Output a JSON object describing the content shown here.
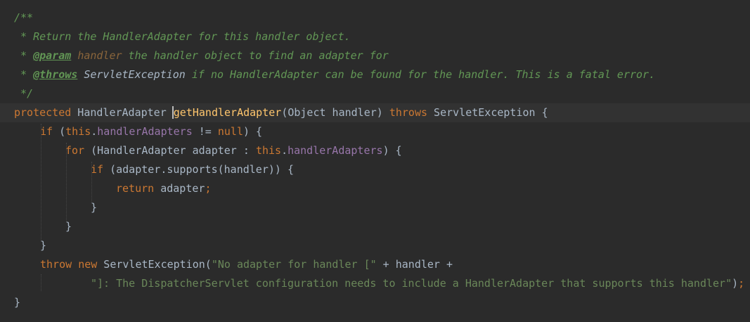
{
  "editor": {
    "colors": {
      "background": "#2b2b2b",
      "current_line": "#323232",
      "comment": "#629755",
      "keyword": "#cc7832",
      "plain": "#a9b7c6",
      "method": "#ffc66d",
      "field": "#9876aa",
      "string": "#6a8759",
      "param_name": "#8a653b"
    },
    "lines": [
      [
        {
          "t": "/**",
          "c": "comment"
        }
      ],
      [
        {
          "t": " * Return the HandlerAdapter for this handler object.",
          "c": "comment"
        }
      ],
      [
        {
          "t": " * ",
          "c": "comment"
        },
        {
          "t": "@param",
          "c": "doctag"
        },
        {
          "t": " ",
          "c": "comment"
        },
        {
          "t": "handler",
          "c": "paramname"
        },
        {
          "t": " the handler object to find an adapter for",
          "c": "comment"
        }
      ],
      [
        {
          "t": " * ",
          "c": "comment"
        },
        {
          "t": "@throws",
          "c": "doctag"
        },
        {
          "t": " ",
          "c": "comment"
        },
        {
          "t": "ServletException",
          "c": "doclink"
        },
        {
          "t": " if no HandlerAdapter can be found for the handler. This is a fatal error.",
          "c": "comment"
        }
      ],
      [
        {
          "t": " */",
          "c": "comment"
        }
      ],
      [
        {
          "t": "protected",
          "c": "keyword"
        },
        {
          "t": " HandlerAdapter ",
          "c": "plain"
        },
        {
          "t": "getHandlerAdapter",
          "c": "method",
          "caret": true
        },
        {
          "t": "(Object handler) ",
          "c": "plain"
        },
        {
          "t": "throws",
          "c": "keyword"
        },
        {
          "t": " ServletException {",
          "c": "plain"
        }
      ],
      [
        {
          "t": "if",
          "c": "keyword"
        },
        {
          "t": " (",
          "c": "plain"
        },
        {
          "t": "this",
          "c": "keyword"
        },
        {
          "t": ".",
          "c": "plain"
        },
        {
          "t": "handlerAdapters",
          "c": "field"
        },
        {
          "t": " != ",
          "c": "plain"
        },
        {
          "t": "null",
          "c": "keyword"
        },
        {
          "t": ") {",
          "c": "plain"
        }
      ],
      [
        {
          "t": "for",
          "c": "keyword"
        },
        {
          "t": " (HandlerAdapter adapter : ",
          "c": "plain"
        },
        {
          "t": "this",
          "c": "keyword"
        },
        {
          "t": ".",
          "c": "plain"
        },
        {
          "t": "handlerAdapters",
          "c": "field"
        },
        {
          "t": ") {",
          "c": "plain"
        }
      ],
      [
        {
          "t": "if",
          "c": "keyword"
        },
        {
          "t": " (adapter.supports(handler)) {",
          "c": "plain"
        }
      ],
      [
        {
          "t": "return",
          "c": "keyword"
        },
        {
          "t": " adapter",
          "c": "plain"
        },
        {
          "t": ";",
          "c": "punct"
        }
      ],
      [
        {
          "t": "}",
          "c": "plain"
        }
      ],
      [
        {
          "t": "}",
          "c": "plain"
        }
      ],
      [
        {
          "t": "}",
          "c": "plain"
        }
      ],
      [
        {
          "t": "throw",
          "c": "keyword"
        },
        {
          "t": " ",
          "c": "plain"
        },
        {
          "t": "new",
          "c": "keyword"
        },
        {
          "t": " ServletException(",
          "c": "plain"
        },
        {
          "t": "\"No adapter for handler [\"",
          "c": "string"
        },
        {
          "t": " + handler +",
          "c": "plain"
        }
      ],
      [
        {
          "t": "\"]: The DispatcherServlet configuration needs to include a HandlerAdapter that supports this handler\"",
          "c": "string"
        },
        {
          "t": ")",
          "c": "plain"
        },
        {
          "t": ";",
          "c": "punct"
        }
      ],
      [
        {
          "t": "}",
          "c": "plain"
        }
      ]
    ]
  }
}
